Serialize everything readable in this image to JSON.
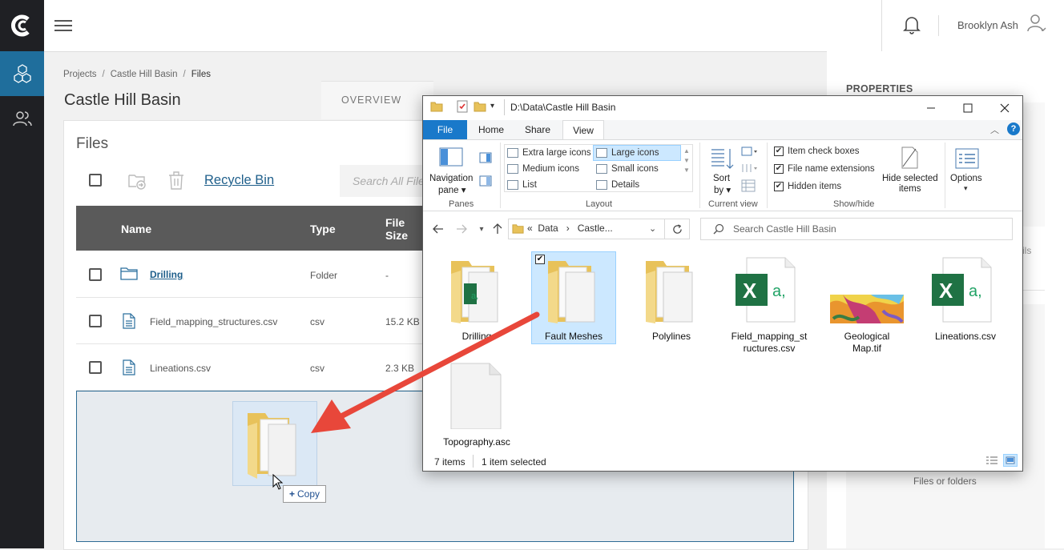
{
  "user": {
    "name": "Brooklyn Ash"
  },
  "breadcrumb": {
    "projects": "Projects",
    "project": "Castle Hill Basin",
    "current": "Files"
  },
  "page_title": "Castle Hill Basin",
  "tabs": {
    "overview": "OVERVIEW"
  },
  "files_panel": {
    "title": "Files",
    "recycle_bin": "Recycle Bin",
    "search_placeholder": "Search All Files",
    "columns": {
      "name": "Name",
      "type": "Type",
      "size": "File Size"
    },
    "rows": [
      {
        "name": "Drilling",
        "type": "Folder",
        "size": "-"
      },
      {
        "name": "Field_mapping_structures.csv",
        "type": "csv",
        "size": "15.2 KB"
      },
      {
        "name": "Lineations.csv",
        "type": "csv",
        "size": "2.3 KB"
      }
    ],
    "drag_badge": "Copy"
  },
  "properties": {
    "title": "PROPERTIES",
    "fragment": "ils",
    "empty_text": "Files or folders"
  },
  "explorer": {
    "title": "D:\\Data\\Castle Hill Basin",
    "menu": {
      "file": "File",
      "home": "Home",
      "share": "Share",
      "view": "View"
    },
    "ribbon": {
      "panes": {
        "navigation": "Navigation",
        "navigation2": "pane",
        "label": "Panes"
      },
      "layout": {
        "items": [
          "Extra large icons",
          "Large icons",
          "Medium icons",
          "Small icons",
          "List",
          "Details"
        ],
        "selected": "Large icons",
        "label": "Layout"
      },
      "current_view": {
        "sort": "Sort",
        "sort2": "by",
        "label": "Current view"
      },
      "show_hide": {
        "item_check_boxes": "Item check boxes",
        "file_name_extensions": "File name extensions",
        "hidden_items": "Hidden items",
        "hide_selected": "Hide selected",
        "hide_selected2": "items",
        "label": "Show/hide"
      },
      "options": "Options"
    },
    "address": {
      "prefix": "«",
      "part1": "Data",
      "part2": "Castle..."
    },
    "search_placeholder": "Search Castle Hill Basin",
    "items": [
      {
        "name": "Drilling",
        "kind": "folder-csv"
      },
      {
        "name": "Fault Meshes",
        "kind": "folder",
        "selected": true
      },
      {
        "name": "Polylines",
        "kind": "folder"
      },
      {
        "name": "Field_mapping_structures.csv",
        "line1": "Field_mapping_st",
        "line2": "ructures.csv",
        "kind": "excel"
      },
      {
        "name": "Geological Map.tif",
        "line1": "Geological",
        "line2": "Map.tif",
        "kind": "image"
      },
      {
        "name": "Lineations.csv",
        "kind": "excel"
      },
      {
        "name": "Topography.asc",
        "kind": "file"
      }
    ],
    "status": {
      "count": "7 items",
      "selection": "1 item selected"
    }
  },
  "colors": {
    "brand_blue": "#1f6e9c",
    "rail": "#1f2024",
    "explorer_accent": "#1979ca",
    "arrow": "#e8473a"
  }
}
